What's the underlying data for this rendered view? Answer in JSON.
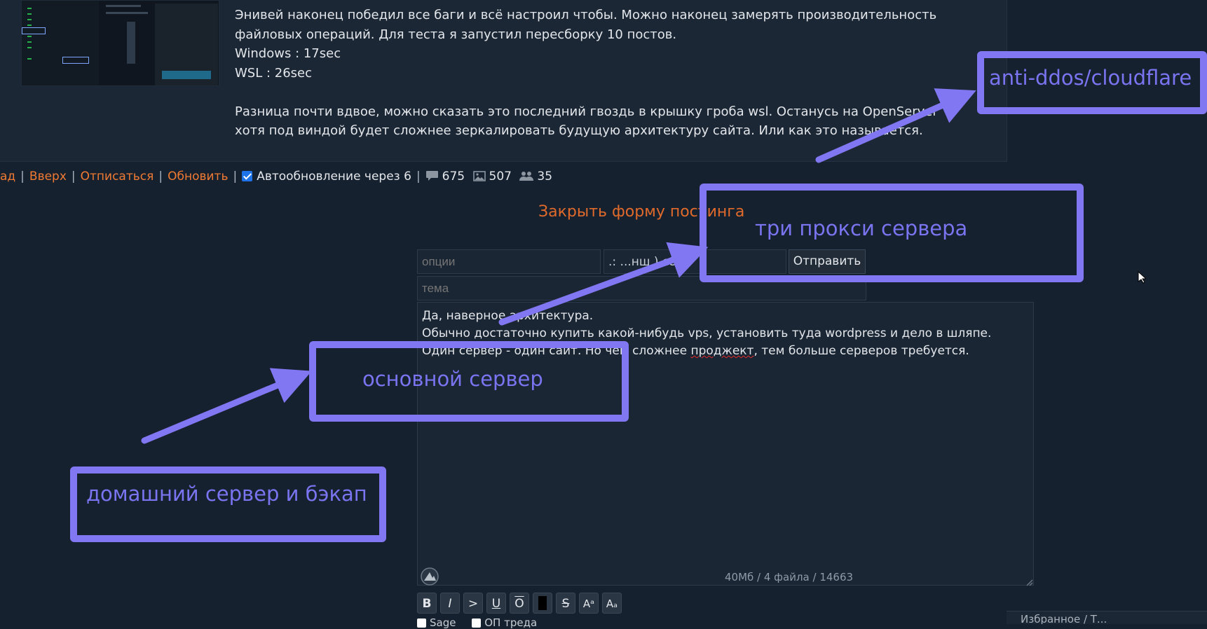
{
  "post": {
    "thumbnail_alt": "",
    "lines": [
      "Энивей наконец победил все баги и всё настроил чтобы. Можно наконец замерять производительность",
      "файловых операций. Для теста я запустил пересборку 10 постов.",
      "Windows : 17sec",
      "WSL : 26sec",
      "",
      "Разница почти вдвое, можно сказать это последний гвоздь в крышку гроба wsl. Останусь на OpenServer",
      "хотя под виндой будет сложнее зеркалировать будущую архитектуру сайта. Или как это называется."
    ]
  },
  "thread_nav": {
    "back": "ад",
    "up": "Вверх",
    "unsubscribe": "Отписаться",
    "refresh": "Обновить",
    "autorefresh": "Автообновление через 6",
    "posts_count": "675",
    "images_count": "507",
    "posters_count": "35"
  },
  "form": {
    "close_label": "Закрыть форму постинга",
    "options_placeholder": "опции",
    "name_value": ".: ...нш ) c8p",
    "send_label": "Отправить",
    "subject_placeholder": "тема",
    "comment_lines": [
      "Да, наверное архитектура.",
      "Обычно достаточно купить какой-нибудь vps, установить туда wordpress и дело в шляпе."
    ],
    "comment_line3_a": "Один сервер - один сайт. Но чем сложнее ",
    "comment_line3_spell": "проджект",
    "comment_line3_b": ", тем больше серверов требуется.",
    "limits": "40Мб / 4 файла / 14663",
    "toolbar": [
      "B",
      "I",
      ">",
      "U",
      "O",
      "",
      "S",
      "Aᵃ",
      "Aₐ"
    ],
    "sage_label": "Sage",
    "op_label": "ОП треда"
  },
  "bottom_panel": "Избранное / Т...",
  "annotations": {
    "cloudflare": "anti-ddos/cloudflare",
    "proxy": "три прокси сервера",
    "main_server": "основной сервер",
    "home_server": "домашний сервер и бэкап"
  },
  "colors": {
    "background": "#16212f",
    "accent_link": "#f07a32",
    "annotation": "#8177f2"
  }
}
